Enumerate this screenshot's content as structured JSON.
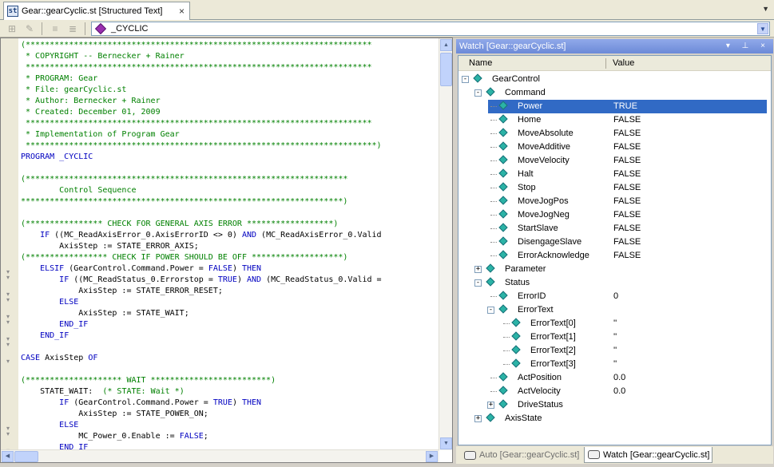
{
  "tab": {
    "icon_text": "st",
    "title": "Gear::gearCyclic.st [Structured Text]",
    "close": "×",
    "dropdown": "▼"
  },
  "toolbar": {
    "program": "_CYCLIC"
  },
  "code_lines": [
    [
      {
        "t": "(************************************************************************",
        "c": "comment"
      }
    ],
    [
      {
        "t": " * COPYRIGHT -- Bernecker + Rainer",
        "c": "comment"
      }
    ],
    [
      {
        "t": " ************************************************************************",
        "c": "comment"
      }
    ],
    [
      {
        "t": " * PROGRAM: Gear",
        "c": "comment"
      }
    ],
    [
      {
        "t": " * File: gearCyclic.st",
        "c": "comment"
      }
    ],
    [
      {
        "t": " * Author: Bernecker + Rainer",
        "c": "comment"
      }
    ],
    [
      {
        "t": " * Created: December 01, 2009",
        "c": "comment"
      }
    ],
    [
      {
        "t": " ************************************************************************",
        "c": "comment"
      }
    ],
    [
      {
        "t": " * Implementation of Program Gear",
        "c": "comment"
      }
    ],
    [
      {
        "t": " *************************************************************************)",
        "c": "comment"
      }
    ],
    [
      {
        "t": "PROGRAM _CYCLIC",
        "c": "kw"
      }
    ],
    [
      {
        "t": "",
        "c": "txt"
      }
    ],
    [
      {
        "t": "(*******************************************************************",
        "c": "comment"
      }
    ],
    [
      {
        "t": "        Control Sequence",
        "c": "comment"
      }
    ],
    [
      {
        "t": "*******************************************************************)",
        "c": "comment"
      }
    ],
    [
      {
        "t": "",
        "c": "txt"
      }
    ],
    [
      {
        "t": "(**************** CHECK FOR GENERAL AXIS ERROR ******************)",
        "c": "comment"
      }
    ],
    [
      {
        "t": "    ",
        "c": "txt"
      },
      {
        "t": "IF",
        "c": "kw"
      },
      {
        "t": " ((MC_ReadAxisError_0.AxisErrorID <> 0) ",
        "c": "txt"
      },
      {
        "t": "AND",
        "c": "kw"
      },
      {
        "t": " (MC_ReadAxisError_0.Valid",
        "c": "txt"
      }
    ],
    [
      {
        "t": "        AxisStep := STATE_ERROR_AXIS;",
        "c": "txt"
      }
    ],
    [
      {
        "t": "(***************** CHECK IF POWER SHOULD BE OFF *******************)",
        "c": "comment"
      }
    ],
    [
      {
        "t": "    ",
        "c": "txt"
      },
      {
        "t": "ELSIF",
        "c": "kw"
      },
      {
        "t": " (GearControl.Command.Power = ",
        "c": "txt"
      },
      {
        "t": "FALSE",
        "c": "kw"
      },
      {
        "t": ") ",
        "c": "txt"
      },
      {
        "t": "THEN",
        "c": "kw"
      }
    ],
    [
      {
        "t": "        ",
        "c": "txt"
      },
      {
        "t": "IF",
        "c": "kw"
      },
      {
        "t": " ((MC_ReadStatus_0.Errorstop = ",
        "c": "txt"
      },
      {
        "t": "TRUE",
        "c": "kw"
      },
      {
        "t": ") ",
        "c": "txt"
      },
      {
        "t": "AND",
        "c": "kw"
      },
      {
        "t": " (MC_ReadStatus_0.Valid =",
        "c": "txt"
      }
    ],
    [
      {
        "t": "            AxisStep := STATE_ERROR_RESET;",
        "c": "txt"
      }
    ],
    [
      {
        "t": "        ",
        "c": "txt"
      },
      {
        "t": "ELSE",
        "c": "kw"
      }
    ],
    [
      {
        "t": "            AxisStep := STATE_WAIT;",
        "c": "txt"
      }
    ],
    [
      {
        "t": "        ",
        "c": "txt"
      },
      {
        "t": "END_IF",
        "c": "kw"
      }
    ],
    [
      {
        "t": "    ",
        "c": "txt"
      },
      {
        "t": "END_IF",
        "c": "kw"
      }
    ],
    [
      {
        "t": "",
        "c": "txt"
      }
    ],
    [
      {
        "t": "CASE",
        "c": "kw"
      },
      {
        "t": " AxisStep ",
        "c": "txt"
      },
      {
        "t": "OF",
        "c": "kw"
      }
    ],
    [
      {
        "t": "",
        "c": "txt"
      }
    ],
    [
      {
        "t": "(******************** WAIT *************************)",
        "c": "comment"
      }
    ],
    [
      {
        "t": "    STATE_WAIT:  ",
        "c": "txt"
      },
      {
        "t": "(* STATE: Wait *)",
        "c": "comment"
      }
    ],
    [
      {
        "t": "        ",
        "c": "txt"
      },
      {
        "t": "IF",
        "c": "kw"
      },
      {
        "t": " (GearControl.Command.Power = ",
        "c": "txt"
      },
      {
        "t": "TRUE",
        "c": "kw"
      },
      {
        "t": ") ",
        "c": "txt"
      },
      {
        "t": "THEN",
        "c": "kw"
      }
    ],
    [
      {
        "t": "            AxisStep := STATE_POWER_ON;",
        "c": "txt"
      }
    ],
    [
      {
        "t": "        ",
        "c": "txt"
      },
      {
        "t": "ELSE",
        "c": "kw"
      }
    ],
    [
      {
        "t": "            MC_Power_0.Enable := ",
        "c": "txt"
      },
      {
        "t": "FALSE",
        "c": "kw"
      },
      {
        "t": ";",
        "c": "txt"
      }
    ],
    [
      {
        "t": "        ",
        "c": "txt"
      },
      {
        "t": "END_IF",
        "c": "kw"
      }
    ]
  ],
  "watch": {
    "title": "Watch [Gear::gearCyclic.st]",
    "buttons": "▾ ⊥ ×",
    "col_name": "Name",
    "col_value": "Value",
    "rows": [
      {
        "name": "GearControl",
        "value": "",
        "level": 0,
        "exp": "−"
      },
      {
        "name": "Command",
        "value": "",
        "level": 1,
        "exp": "−"
      },
      {
        "name": "Power",
        "value": "TRUE",
        "level": 2,
        "exp": "",
        "sel": true
      },
      {
        "name": "Home",
        "value": "FALSE",
        "level": 2,
        "exp": ""
      },
      {
        "name": "MoveAbsolute",
        "value": "FALSE",
        "level": 2,
        "exp": ""
      },
      {
        "name": "MoveAdditive",
        "value": "FALSE",
        "level": 2,
        "exp": ""
      },
      {
        "name": "MoveVelocity",
        "value": "FALSE",
        "level": 2,
        "exp": ""
      },
      {
        "name": "Halt",
        "value": "FALSE",
        "level": 2,
        "exp": ""
      },
      {
        "name": "Stop",
        "value": "FALSE",
        "level": 2,
        "exp": ""
      },
      {
        "name": "MoveJogPos",
        "value": "FALSE",
        "level": 2,
        "exp": ""
      },
      {
        "name": "MoveJogNeg",
        "value": "FALSE",
        "level": 2,
        "exp": ""
      },
      {
        "name": "StartSlave",
        "value": "FALSE",
        "level": 2,
        "exp": ""
      },
      {
        "name": "DisengageSlave",
        "value": "FALSE",
        "level": 2,
        "exp": ""
      },
      {
        "name": "ErrorAcknowledge",
        "value": "FALSE",
        "level": 2,
        "exp": ""
      },
      {
        "name": "Parameter",
        "value": "",
        "level": 1,
        "exp": "+"
      },
      {
        "name": "Status",
        "value": "",
        "level": 1,
        "exp": "−"
      },
      {
        "name": "ErrorID",
        "value": "0",
        "level": 2,
        "exp": ""
      },
      {
        "name": "ErrorText",
        "value": "",
        "level": 2,
        "exp": "−"
      },
      {
        "name": "ErrorText[0]",
        "value": "''",
        "level": 3,
        "exp": ""
      },
      {
        "name": "ErrorText[1]",
        "value": "''",
        "level": 3,
        "exp": ""
      },
      {
        "name": "ErrorText[2]",
        "value": "''",
        "level": 3,
        "exp": ""
      },
      {
        "name": "ErrorText[3]",
        "value": "''",
        "level": 3,
        "exp": ""
      },
      {
        "name": "ActPosition",
        "value": "0.0",
        "level": 2,
        "exp": ""
      },
      {
        "name": "ActVelocity",
        "value": "0.0",
        "level": 2,
        "exp": ""
      },
      {
        "name": "DriveStatus",
        "value": "",
        "level": 2,
        "exp": "+"
      },
      {
        "name": "AxisState",
        "value": "",
        "level": 1,
        "exp": "+"
      }
    ]
  },
  "bottom_tabs": {
    "auto": "Auto [Gear::gearCyclic.st]",
    "watch": "Watch [Gear::gearCyclic.st]"
  }
}
